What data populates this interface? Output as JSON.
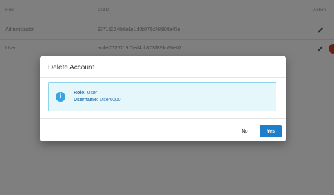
{
  "table": {
    "columns": {
      "role": "Role",
      "guid": "GUID",
      "action": "Action"
    },
    "rows": [
      {
        "role": "Administrator",
        "guid": "93715224fb6e1e1d0b075c76f808a47e"
      },
      {
        "role": "User",
        "guid": "acdef7725719 7fed4cb873289bb30e02"
      }
    ]
  },
  "dialog": {
    "title": "Delete Account",
    "info": {
      "role_key": "Role:",
      "role_value": "User",
      "username_key": "Username:",
      "username_value": "User0000"
    },
    "buttons": {
      "no": "No",
      "yes": "Yes"
    }
  },
  "colors": {
    "primary": "#1d7fc9",
    "info_bg": "#e6f7fc",
    "info_border": "#8fd3ea",
    "info_icon": "#3aa6e0",
    "delete_red": "#d33a2c"
  }
}
